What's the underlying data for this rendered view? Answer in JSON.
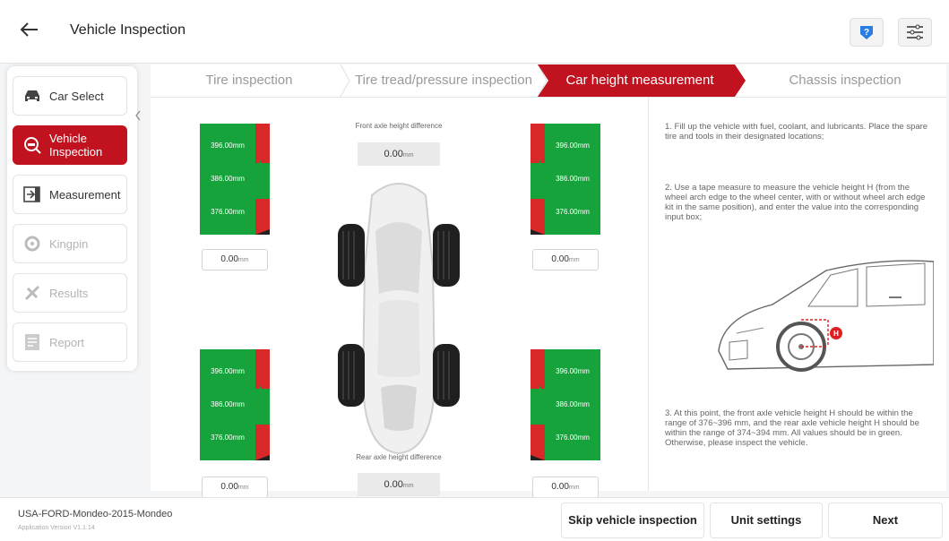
{
  "header": {
    "title": "Vehicle Inspection",
    "back_icon": "arrow-left-icon",
    "help_icon": "help-icon",
    "settings_icon": "sliders-icon"
  },
  "sidebar": {
    "items": [
      {
        "label": "Car Select",
        "icon": "car-icon",
        "state": "normal"
      },
      {
        "label": "Vehicle\nInspection",
        "icon": "inspection-icon",
        "state": "active"
      },
      {
        "label": "Measurement",
        "icon": "measurement-icon",
        "state": "normal"
      },
      {
        "label": "Kingpin",
        "icon": "kingpin-icon",
        "state": "disabled"
      },
      {
        "label": "Results",
        "icon": "results-icon",
        "state": "disabled"
      },
      {
        "label": "Report",
        "icon": "report-icon",
        "state": "disabled"
      }
    ]
  },
  "steps": [
    {
      "label": "Tire inspection",
      "active": false
    },
    {
      "label": "Tire tread/pressure inspection",
      "active": false
    },
    {
      "label": "Car height measurement",
      "active": true
    },
    {
      "label": "Chassis inspection",
      "active": false
    }
  ],
  "measure": {
    "front_diff_label": "Front axle height difference",
    "rear_diff_label": "Rear axle height difference",
    "front_diff_value": "0.00",
    "rear_diff_value": "0.00",
    "diff_unit": "mm",
    "gauge_labels": [
      "396.00mm",
      "386.00mm",
      "376.00mm"
    ],
    "gauge_labels_rear_left": [
      "396.00mm",
      "386.00mm",
      "376.00mm"
    ],
    "inputs": {
      "front_left": "0.00",
      "front_right": "0.00",
      "rear_left": "0.00",
      "rear_right": "0.00",
      "unit": "mm"
    }
  },
  "instructions": {
    "p1": "1. Fill up the vehicle with fuel, coolant, and lubricants. Place the spare tire and tools in their designated locations;",
    "p2": "2. Use a tape measure to measure the vehicle height H (from the wheel arch edge to the wheel center, with or without wheel arch edge kit in the same position), and enter the value into the corresponding input box;",
    "p3": "3. At this point, the front axle vehicle height H should be within the range of 376~396 mm, and the rear axle vehicle height H should be within the range of 374~394 mm. All values should be in green. Otherwise, please inspect the vehicle.",
    "h_marker": "H"
  },
  "footer": {
    "vehicle": "USA-FORD-Mondeo-2015-Mondeo",
    "version": "Application Version V1.1.14",
    "skip": "Skip vehicle inspection",
    "unit": "Unit settings",
    "next": "Next"
  },
  "colors": {
    "accent": "#c1121f",
    "green": "#17a33c",
    "red": "#d92828"
  }
}
